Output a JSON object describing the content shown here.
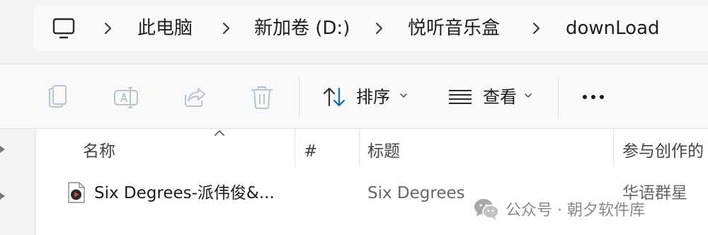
{
  "address_bar": {
    "breadcrumbs": [
      {
        "label": "此电脑"
      },
      {
        "label": "新加卷 (D:)"
      },
      {
        "label": "悦听音乐盒"
      },
      {
        "label": "downLoad"
      }
    ]
  },
  "command_bar": {
    "sort_label": "排序",
    "view_label": "查看",
    "icons": [
      "copy-icon",
      "rename-icon",
      "share-icon",
      "delete-icon",
      "sort-icon",
      "view-icon",
      "more-icon"
    ]
  },
  "file_list": {
    "columns": {
      "name": "名称",
      "number": "#",
      "title": "标题",
      "contributing_artists": "参与创作的"
    },
    "sorted_by": "name",
    "rows": [
      {
        "name": "Six Degrees-派伟俊&...",
        "number": "",
        "title": "Six Degrees",
        "contributing_artists": "华语群星"
      }
    ]
  },
  "watermark": {
    "text": "公众号 · 朝夕软件库"
  },
  "colors": {
    "background": "#f3f3f3",
    "bar_background": "#f9f9f9",
    "pane_background": "#ffffff",
    "accent": "#0067c0"
  }
}
